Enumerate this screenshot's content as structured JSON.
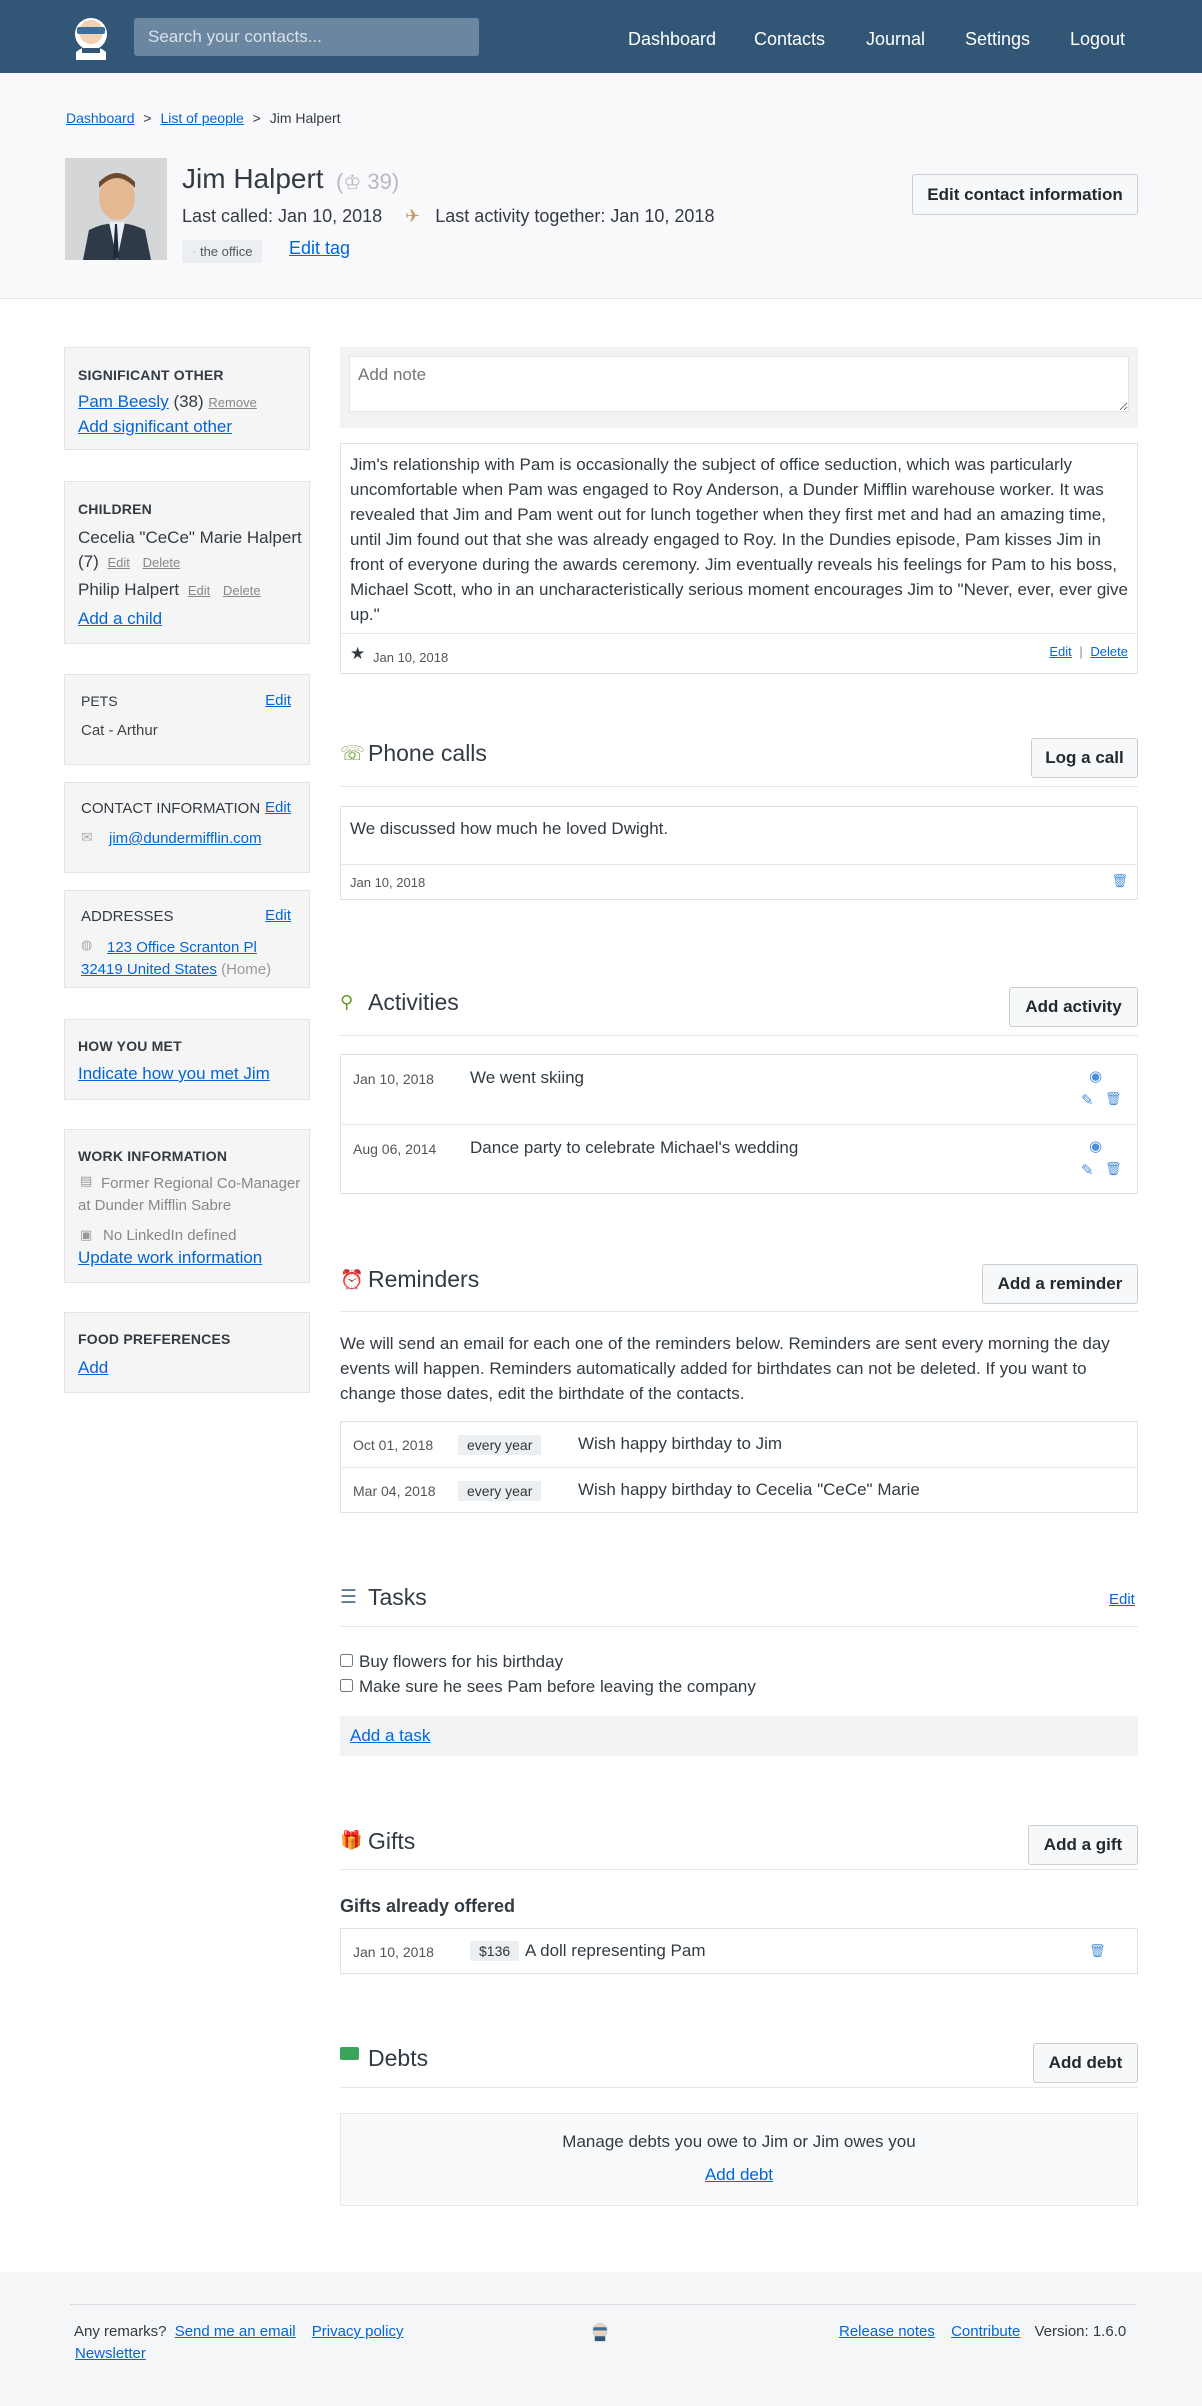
{
  "nav": {
    "search_placeholder": "Search your contacts...",
    "dashboard": "Dashboard",
    "contacts": "Contacts",
    "journal": "Journal",
    "settings": "Settings",
    "logout": "Logout"
  },
  "breadcrumb": {
    "dashboard": "Dashboard",
    "list": "List of people",
    "current": "Jim Halpert",
    "sep": ">"
  },
  "contact": {
    "name": "Jim Halpert",
    "age": "39",
    "last_called": "Last called: Jan 10, 2018",
    "last_activity": "Last activity together: Jan 10, 2018",
    "tag": "the office",
    "edit_tag": "Edit tag",
    "edit_contact": "Edit contact information"
  },
  "sidebar": {
    "significant_other": {
      "title": "SIGNIFICANT OTHER",
      "name": "Pam Beesly",
      "age": "(38)",
      "remove": "Remove",
      "add": "Add significant other"
    },
    "children": {
      "title": "CHILDREN",
      "child1_name": "Cecelia \"CeCe\" Marie Halpert",
      "child1_age": "(7)",
      "child2_name": "Philip Halpert",
      "edit": "Edit",
      "delete": "Delete",
      "add": "Add a child"
    },
    "pets": {
      "title": "PETS",
      "edit": "Edit",
      "item": "Cat - Arthur"
    },
    "contact_info": {
      "title": "CONTACT INFORMATION",
      "edit": "Edit",
      "email": "jim@dundermifflin.com"
    },
    "addresses": {
      "title": "ADDRESSES",
      "edit": "Edit",
      "line1": "123 Office Scranton Pl",
      "line2": "32419 United States",
      "type": "(Home)"
    },
    "how_met": {
      "title": "HOW YOU MET",
      "link": "Indicate how you met Jim"
    },
    "work": {
      "title": "WORK INFORMATION",
      "job": "Former Regional Co-Manager at Dunder Mifflin Sabre",
      "linkedin": "No LinkedIn defined",
      "update": "Update work information"
    },
    "food": {
      "title": "FOOD PREFERENCES",
      "add": "Add"
    }
  },
  "note": {
    "placeholder": "Add note",
    "text": "Jim's relationship with Pam is occasionally the subject of office seduction, which was particularly uncomfortable when Pam was engaged to Roy Anderson, a Dunder Mifflin warehouse worker. It was revealed that Jim and Pam went out for lunch together when they first met and had an amazing time, until Jim found out that she was already engaged to Roy. In the Dundies episode, Pam kisses Jim in front of everyone during the awards ceremony. Jim eventually reveals his feelings for Pam to his boss, Michael Scott, who in an uncharacteristically serious moment encourages Jim to \"Never, ever, ever give up.\"",
    "date": "Jan 10, 2018",
    "edit": "Edit",
    "sep": "|",
    "delete": "Delete"
  },
  "calls": {
    "title": "Phone calls",
    "button": "Log a call",
    "text": "We discussed how much he loved Dwight.",
    "date": "Jan 10, 2018"
  },
  "activities": {
    "title": "Activities",
    "button": "Add activity",
    "items": [
      {
        "date": "Jan 10, 2018",
        "text": "We went skiing"
      },
      {
        "date": "Aug 06, 2014",
        "text": "Dance party to celebrate Michael's wedding"
      }
    ]
  },
  "reminders": {
    "title": "Reminders",
    "button": "Add a reminder",
    "description": "We will send an email for each one of the reminders below. Reminders are sent every morning the day events will happen. Reminders automatically added for birthdates can not be deleted. If you want to change those dates, edit the birthdate of the contacts.",
    "items": [
      {
        "date": "Oct 01, 2018",
        "freq": "every year",
        "text": "Wish happy birthday to Jim"
      },
      {
        "date": "Mar 04, 2018",
        "freq": "every year",
        "text": "Wish happy birthday to Cecelia \"CeCe\" Marie"
      }
    ]
  },
  "tasks": {
    "title": "Tasks",
    "edit": "Edit",
    "items": [
      "Buy flowers for his birthday",
      "Make sure he sees Pam before leaving the company"
    ],
    "add": "Add a task"
  },
  "gifts": {
    "title": "Gifts",
    "button": "Add a gift",
    "subtitle": "Gifts already offered",
    "date": "Jan 10, 2018",
    "price": "$136",
    "text": "A doll representing Pam"
  },
  "debts": {
    "title": "Debts",
    "button": "Add debt",
    "text": "Manage debts you owe to Jim or Jim owes you",
    "link": "Add debt"
  },
  "footer": {
    "remarks": "Any remarks?",
    "email": "Send me an email",
    "privacy": "Privacy policy",
    "newsletter": "Newsletter",
    "release": "Release notes",
    "contribute": "Contribute",
    "version": "Version: 1.6.0"
  },
  "colors": {
    "topbar": "#325776",
    "link": "#0366d6"
  }
}
